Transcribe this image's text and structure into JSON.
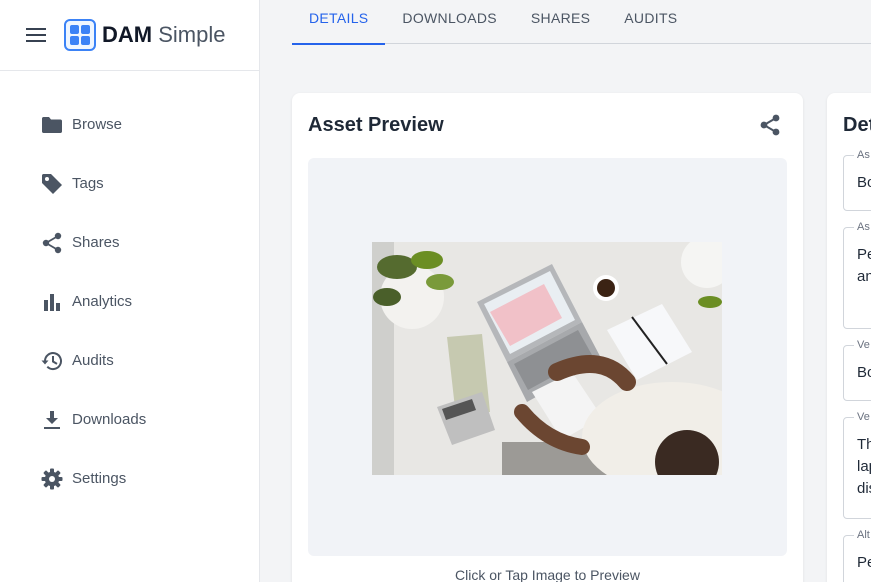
{
  "app": {
    "brand_bold": "DAM",
    "brand_light": " Simple",
    "accent": "#2563eb"
  },
  "sidebar": {
    "items": [
      {
        "label": "Browse",
        "icon": "folder-icon"
      },
      {
        "label": "Tags",
        "icon": "tag-icon"
      },
      {
        "label": "Shares",
        "icon": "share-icon"
      },
      {
        "label": "Analytics",
        "icon": "bar-chart-icon"
      },
      {
        "label": "Audits",
        "icon": "history-icon"
      },
      {
        "label": "Downloads",
        "icon": "download-icon"
      },
      {
        "label": "Settings",
        "icon": "gear-icon"
      }
    ]
  },
  "tabs": [
    {
      "label": "DETAILS",
      "active": true
    },
    {
      "label": "DOWNLOADS",
      "active": false
    },
    {
      "label": "SHARES",
      "active": false
    },
    {
      "label": "AUDITS",
      "active": false
    }
  ],
  "preview": {
    "title": "Asset Preview",
    "caption": "Click or Tap Image to Preview"
  },
  "details": {
    "title": "Det",
    "fields": [
      {
        "label": "As",
        "value": "Bo"
      },
      {
        "label": "As",
        "value": "Pe\nan"
      },
      {
        "label": "Ve",
        "value": "Bo"
      },
      {
        "label": "Ve",
        "value": "Th\nlap\ndis"
      },
      {
        "label": "Alt",
        "value": "Pe"
      }
    ]
  }
}
